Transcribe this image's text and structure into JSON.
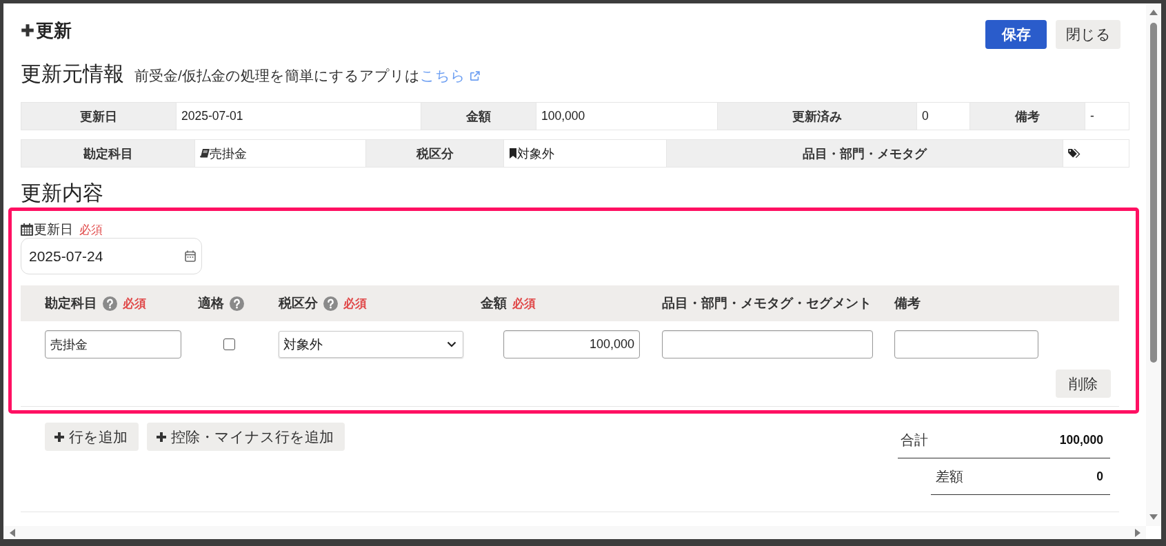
{
  "dialog": {
    "title": "更新",
    "buttons": [
      {
        "label": "保存",
        "kind": "primary"
      },
      {
        "label": "閉じる",
        "kind": "secondary"
      }
    ]
  },
  "source": {
    "heading": "更新元情報",
    "note": "前受金/仮払金の処理を簡単にするアプリは",
    "link": "こちら",
    "rows": [
      [
        {
          "label": "更新日",
          "value": "2025-07-01"
        },
        {
          "label": "金額",
          "value": "100,000"
        },
        {
          "label": "更新済み",
          "value": "0"
        },
        {
          "label": "備考",
          "value": "-"
        }
      ],
      [
        {
          "label": "勘定科目",
          "value": "売掛金",
          "kind": "account"
        },
        {
          "label": "税区分",
          "value": "対象外",
          "kind": "tax"
        },
        {
          "label": "品目・部門・メモタグ",
          "kind": "tags"
        }
      ]
    ]
  },
  "update": {
    "heading": "更新内容",
    "highlighted": true,
    "date": {
      "label": "更新日",
      "required": "必須",
      "value": "2025-07-24"
    },
    "columns": [
      {
        "label": "勘定科目",
        "help": true,
        "required": "必須"
      },
      {
        "label": "適格",
        "help": true
      },
      {
        "label": "税区分",
        "help": true,
        "required": "必須"
      },
      {
        "label": "金額",
        "help": false,
        "required": "必須"
      },
      {
        "label": "品目・部門・メモタグ・セグメント",
        "help": false
      },
      {
        "label": "備考",
        "help": false
      }
    ],
    "rows": [
      {
        "cells": [
          {
            "kind": "text",
            "value": "売掛金"
          },
          {
            "kind": "checkbox",
            "checked": false
          },
          {
            "kind": "select",
            "value": "対象外"
          },
          {
            "kind": "amount",
            "value": "100,000"
          },
          {
            "kind": "text"
          },
          {
            "kind": "text"
          }
        ],
        "delete_button": "削除"
      }
    ],
    "add_buttons": [
      "行を追加",
      "控除・マイナス行を追加"
    ],
    "totals": [
      {
        "kind": "total",
        "label": "合計",
        "value": "100,000"
      },
      {
        "kind": "difference",
        "label": "差額",
        "value": "0"
      }
    ]
  }
}
